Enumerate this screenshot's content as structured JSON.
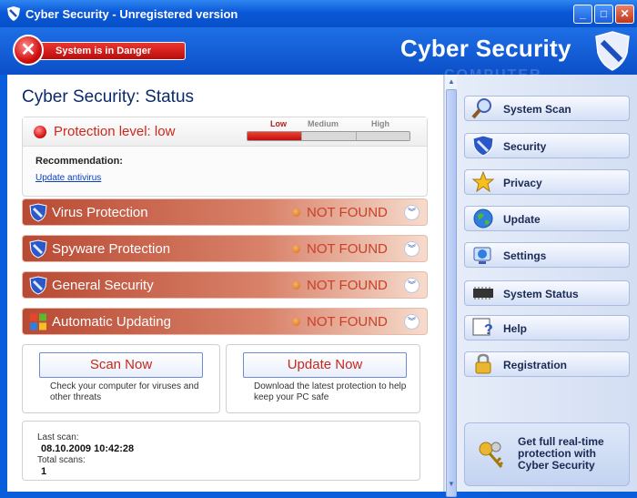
{
  "window": {
    "title": "Cyber Security - Unregistered version"
  },
  "header": {
    "danger_text": "System is in Danger",
    "brand": "Cyber Security",
    "watermark": "COMPUTER"
  },
  "status": {
    "title": "Cyber Security: Status",
    "protection_label": "Protection level: low",
    "levels": [
      "Low",
      "Medium",
      "High"
    ],
    "protection_fraction": 0.33,
    "recommendation_label": "Recommendation:",
    "recommendation_link": "Update antivirus"
  },
  "components": [
    {
      "name": "Virus Protection",
      "status": "NOT FOUND",
      "icon": "shield-icon"
    },
    {
      "name": "Spyware Protection",
      "status": "NOT FOUND",
      "icon": "shield-icon"
    },
    {
      "name": "General Security",
      "status": "NOT FOUND",
      "icon": "shield-icon"
    },
    {
      "name": "Automatic Updating",
      "status": "NOT FOUND",
      "icon": "windows-logo-icon"
    }
  ],
  "actions": {
    "scan": {
      "label": "Scan Now",
      "desc": "Check your computer for viruses and other threats"
    },
    "update": {
      "label": "Update Now",
      "desc": "Download the latest protection to help keep your PC safe"
    }
  },
  "stats": {
    "last_scan_label": "Last scan:",
    "last_scan_value": "08.10.2009 10:42:28",
    "total_scans_label": "Total scans:",
    "total_scans_value": "1"
  },
  "nav": [
    {
      "label": "System Scan",
      "icon": "magnifier-icon"
    },
    {
      "label": "Security",
      "icon": "shield-icon"
    },
    {
      "label": "Privacy",
      "icon": "star-icon"
    },
    {
      "label": "Update",
      "icon": "globe-icon"
    },
    {
      "label": "Settings",
      "icon": "settings-icon"
    },
    {
      "label": "System Status",
      "icon": "chip-icon"
    },
    {
      "label": "Help",
      "icon": "help-icon"
    },
    {
      "label": "Registration",
      "icon": "lock-icon"
    }
  ],
  "promo": {
    "text": "Get full real-time protection with Cyber Security"
  },
  "colors": {
    "title_blue": "#0a5ddb",
    "danger_red": "#d21010",
    "row_red": "#b84a34",
    "not_found": "#c8402a"
  }
}
